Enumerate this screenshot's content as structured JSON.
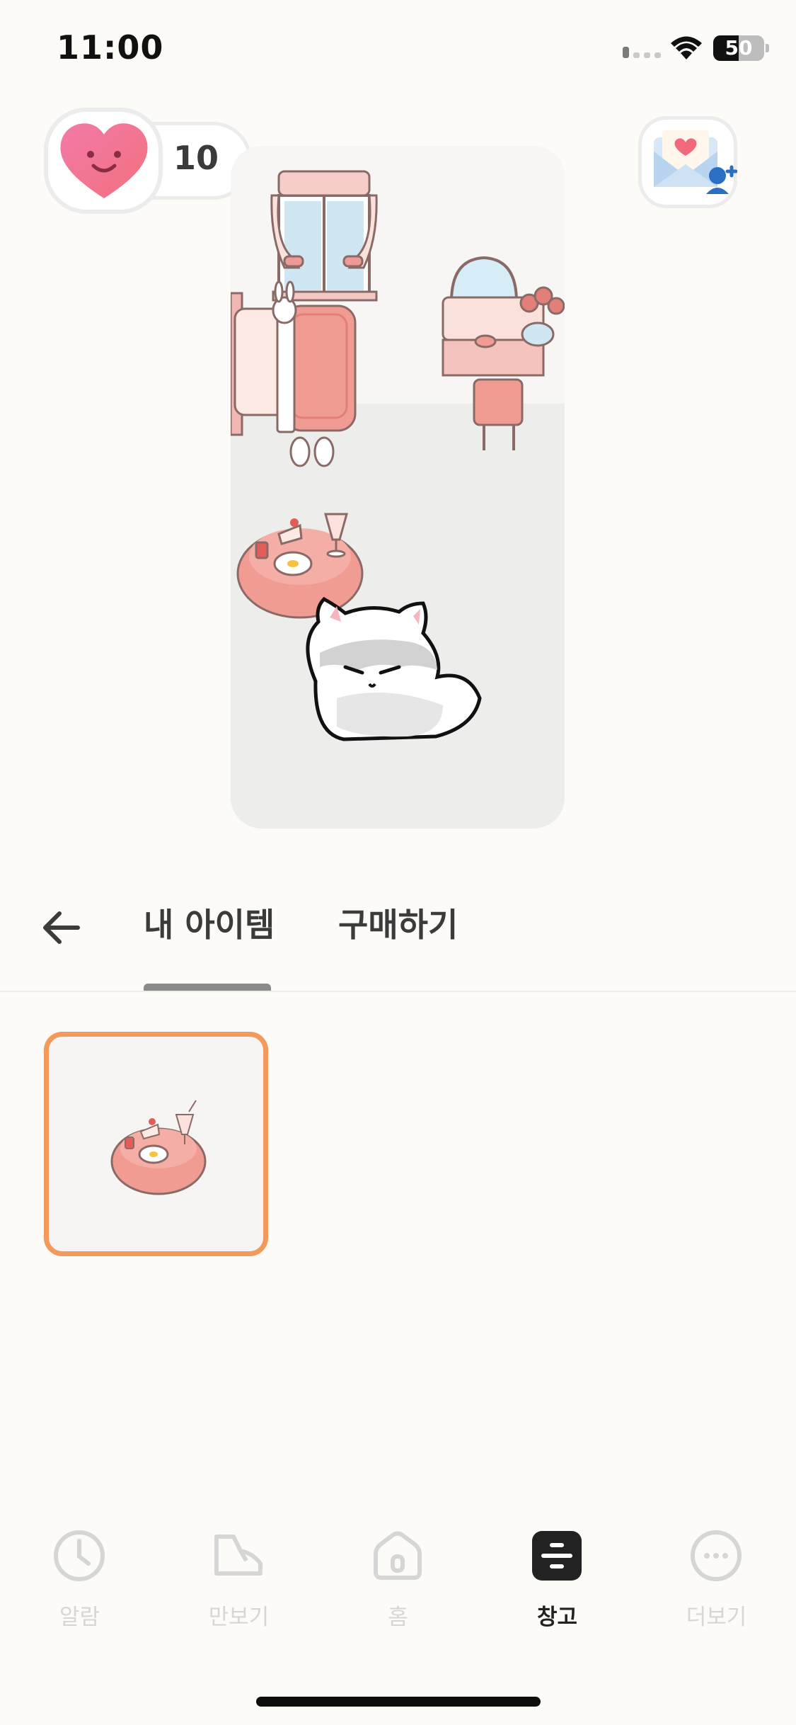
{
  "status_bar": {
    "time": "11:00",
    "battery": "50",
    "icons": [
      "signal-icon",
      "wifi-icon",
      "battery-icon"
    ]
  },
  "top": {
    "heart_count": "10",
    "heart_icon": "smiling-heart-icon",
    "invite_icon": "mail-add-friend-icon"
  },
  "room": {
    "scene": "cat-room-illustration"
  },
  "tabs": {
    "back_icon": "arrow-left-icon",
    "my_items": "내 아이템",
    "purchase": "구매하기",
    "active": "my_items"
  },
  "items": [
    {
      "icon": "dining-table-item-icon",
      "selected": true
    }
  ],
  "bottom_nav": [
    {
      "label": "알람",
      "icon": "clock-icon"
    },
    {
      "label": "만보기",
      "icon": "shoe-icon"
    },
    {
      "label": "홈",
      "icon": "house-icon"
    },
    {
      "label": "창고",
      "icon": "storage-icon",
      "active": true
    },
    {
      "label": "더보기",
      "icon": "more-icon"
    }
  ],
  "colors": {
    "accent": "#f2995b",
    "background": "#fdfbf7",
    "inactive": "#d6d6d6"
  }
}
